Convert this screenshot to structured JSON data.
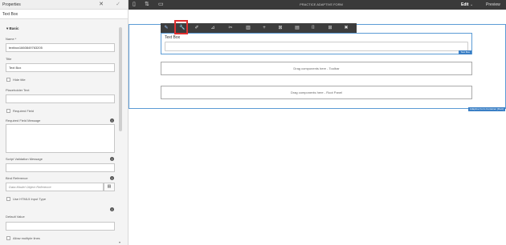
{
  "panel": {
    "title": "Properties",
    "close": "✕",
    "done": "✓",
    "subtitle": "Text Box",
    "section": "Basic",
    "name_label": "Name *",
    "name_value": "textbox1660849763205",
    "title_label": "Title",
    "title_value": "Text Box",
    "hide_title": "Hide title",
    "placeholder_label": "Placeholder Text",
    "required_field": "Required Field",
    "required_message_label": "Required Field Message",
    "script_validation_label": "Script Validation Message",
    "bind_reference_label": "Bind Reference",
    "bind_reference_placeholder": "Data Model Object Reference",
    "html5_input_type": "Use HTML5 Input Type",
    "default_value_label": "Default Value",
    "allow_multiple_lines": "Allow multiple lines"
  },
  "topbar": {
    "page_title": "PRACTICE ADAPTIVE FORM",
    "mode": "Edit",
    "mode_chevron": "⌄",
    "preview": "Preview"
  },
  "canvas": {
    "textbox_label": "Text Box",
    "textbox_tag": "Text Box",
    "drop_toolbar": "Drag components here - Toolbar",
    "drop_root": "Drag components here - Root Panel",
    "root_tag": "Adaptive Form Container [Root]"
  },
  "toolbar_icons": [
    "pencil-icon",
    "wrench-icon",
    "style-icon",
    "edit-layout-icon",
    "cut-icon",
    "delete-icon",
    "plus-icon",
    "replace-icon",
    "group-icon",
    "rules-icon",
    "convert-icon",
    "close-toolbar-icon"
  ],
  "accent": "#5b9bd5",
  "highlight": "#e03030"
}
